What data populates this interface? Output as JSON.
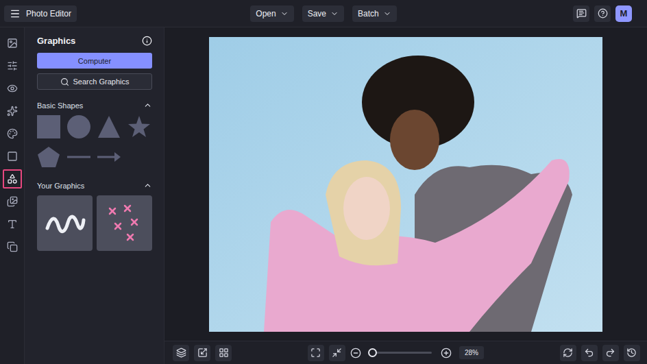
{
  "app": {
    "title": "Photo Editor",
    "menus": [
      {
        "label": "Open"
      },
      {
        "label": "Save"
      },
      {
        "label": "Batch"
      }
    ],
    "avatar": "M"
  },
  "rail": [
    {
      "kind": "image",
      "selected": false
    },
    {
      "kind": "adjust",
      "selected": false
    },
    {
      "kind": "eye",
      "selected": false
    },
    {
      "kind": "effects",
      "selected": false
    },
    {
      "kind": "palette",
      "selected": false
    },
    {
      "kind": "frame",
      "selected": false
    },
    {
      "kind": "graphics",
      "selected": true
    },
    {
      "kind": "texture",
      "selected": false
    },
    {
      "kind": "text",
      "selected": false
    },
    {
      "kind": "overlay",
      "selected": false
    }
  ],
  "panel": {
    "title": "Graphics",
    "primary_button": "Computer",
    "search": "Search Graphics",
    "sections": [
      {
        "title": "Basic Shapes",
        "expanded": true,
        "items": [
          {
            "kind": "square"
          },
          {
            "kind": "circle"
          },
          {
            "kind": "triangle"
          },
          {
            "kind": "star"
          },
          {
            "kind": "pentagon"
          },
          {
            "kind": "line"
          },
          {
            "kind": "arrow"
          }
        ]
      },
      {
        "title": "Your Graphics",
        "expanded": true,
        "items": [
          {
            "kind": "squiggle"
          },
          {
            "kind": "sparkles"
          }
        ]
      }
    ]
  },
  "zoom": {
    "level": 0.03,
    "reading": "28%"
  }
}
